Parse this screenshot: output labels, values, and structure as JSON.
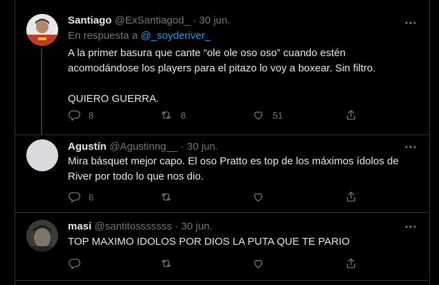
{
  "tweets": [
    {
      "name": "Santiago",
      "handle": "@ExSantiagod_",
      "sep": "·",
      "time": "30 jun.",
      "reply_prefix": "En respuesta a",
      "reply_to": "@_soyderiver_",
      "paragraphs": [
        "A la primer basura que cante “ole ole oso oso” cuando estén acomodándose los players para el pitazo lo voy a boxear. Sin filtro.",
        "QUIERO GUERRA."
      ],
      "replies": "8",
      "retweets": "8",
      "likes": "51",
      "avatar_color": "#c0392b"
    },
    {
      "name": "Agustín",
      "handle": "@Agustinng__",
      "sep": "·",
      "time": "30 jun.",
      "paragraphs": [
        "Mira básquet mejor capo. El oso Pratto es top de los máximos ídolos de River por todo lo que nos dio."
      ],
      "replies": "6",
      "retweets": "",
      "likes": "",
      "avatar_color": "#d9d9de"
    },
    {
      "name": "masi",
      "handle": "@santitosssssss",
      "sep": "·",
      "time": "30 jun.",
      "paragraphs": [
        "TOP MAXIMO IDOLOS POR DIOS LA PUTA QUE TE PARIO"
      ],
      "replies": "",
      "retweets": "",
      "likes": "",
      "avatar_color": "#4a4a4a"
    }
  ],
  "icons": {
    "more": "more-dots-icon",
    "reply": "reply-icon",
    "retweet": "retweet-icon",
    "like": "heart-icon",
    "share": "share-icon"
  },
  "colors": {
    "background": "#000000",
    "text": "#e7e9ea",
    "secondary": "#71767b",
    "link": "#1d9bf0",
    "border": "#2f3336"
  }
}
